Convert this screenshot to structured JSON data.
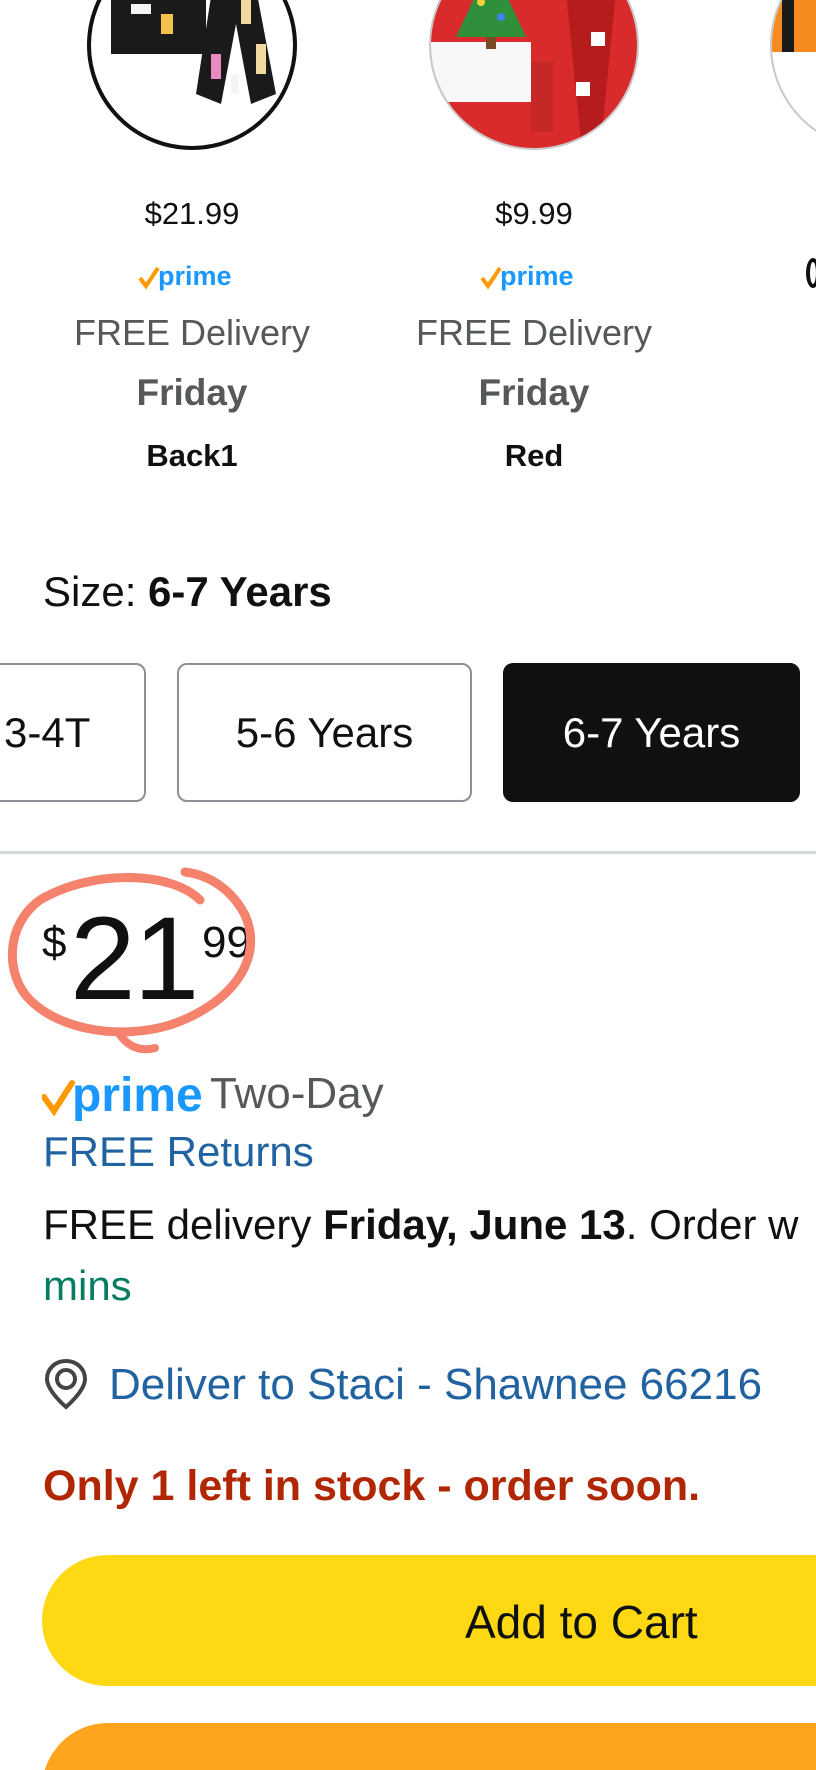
{
  "variants": [
    {
      "price": "$21.99",
      "delivery": "FREE Delivery",
      "day": "Friday",
      "name": "Back1",
      "image": "skeleton-pajama-thumbnail",
      "selected": true
    },
    {
      "price": "$9.99",
      "delivery": "FREE Delivery",
      "day": "Friday",
      "name": "Red",
      "image": "christmas-pajama-thumbnail",
      "selected": false
    }
  ],
  "prime_badge": "prime",
  "size": {
    "label": "Size: ",
    "selected": "6-7 Years",
    "options": [
      "3-4T",
      "5-6 Years",
      "6-7 Years"
    ]
  },
  "price": {
    "currency": "$",
    "whole": "21",
    "fraction": "99"
  },
  "shipping": {
    "speed": "Two-Day"
  },
  "returns": "FREE Returns",
  "delivery": {
    "prefix": "FREE delivery ",
    "date": "Friday, June 13",
    "suffix": ". Order w",
    "countdown_tail": "mins"
  },
  "deliver_to": "Deliver to Staci - Shawnee 66216",
  "stock": "Only 1 left in stock - order soon.",
  "add_to_cart": "Add to Cart",
  "colors": {
    "link": "#2162a1",
    "stock_red": "#b12704",
    "countdown_green": "#067d62",
    "cart_yellow": "#ffd814",
    "buy_orange": "#ffa41c",
    "prime_blue": "#1a98ff",
    "prime_check_orange": "#ff9900",
    "annotation_circle": "#f4826c"
  }
}
